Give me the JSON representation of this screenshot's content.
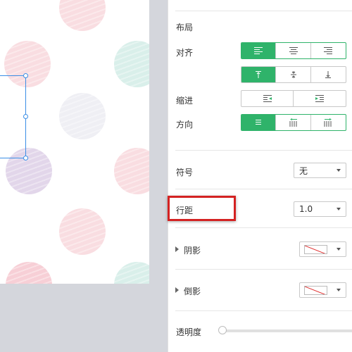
{
  "panel": {
    "section_title": "布局",
    "align": {
      "label": "对齐",
      "horizontal": [
        "left",
        "center",
        "right"
      ],
      "horizontal_selected": "left",
      "vertical": [
        "top",
        "middle",
        "bottom"
      ],
      "vertical_selected": "top"
    },
    "indent": {
      "label": "缩进",
      "options": [
        "decrease-indent",
        "increase-indent"
      ]
    },
    "direction": {
      "label": "方向",
      "options": [
        "horizontal",
        "vertical-rtl",
        "vertical-ltr"
      ],
      "selected": "horizontal"
    },
    "bullet": {
      "label": "符号",
      "value": "无"
    },
    "line_spacing": {
      "label": "行距",
      "value": "1.0"
    },
    "shadow": {
      "label": "阴影",
      "value_icon": "no-color-swatch"
    },
    "reflection": {
      "label": "倒影",
      "value_icon": "no-color-swatch"
    },
    "opacity": {
      "label": "透明度",
      "value": 0
    }
  },
  "colors": {
    "accent_green": "#2fb36a",
    "highlight_red": "#d42222",
    "selection_blue": "#3a8ee6"
  }
}
